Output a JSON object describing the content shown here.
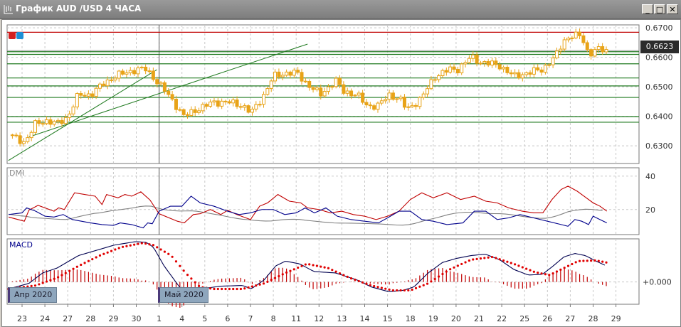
{
  "window": {
    "title": "График AUD /USD  4 ЧАСА",
    "buttons": {
      "minimize": "_",
      "maximize": "□",
      "close": "✕"
    }
  },
  "colors": {
    "candle": "#e8a317",
    "resistance": "#c00000",
    "support": "#1f7a1f",
    "plus_di": "#c00000",
    "minus_di": "#00008b",
    "adx": "#808080",
    "macd": "#000050",
    "signal": "#e00000",
    "grid": "#c8c8c8"
  },
  "price_panel": {
    "axis_labels": [
      "0.6700",
      "0.6600",
      "0.6500",
      "0.6400",
      "0.6300"
    ],
    "axis_values": [
      0.67,
      0.66,
      0.65,
      0.64,
      0.63
    ],
    "current_price": "0.6623",
    "current_value": 0.6623,
    "range": [
      0.624,
      0.671
    ],
    "resistance_level": 0.6685,
    "support_levels": [
      0.6619,
      0.661,
      0.6578,
      0.653,
      0.6503,
      0.6464,
      0.6399,
      0.638
    ],
    "trendlines": [
      {
        "from": [
          -0.6,
          0.625
        ],
        "to": [
          5.9,
          0.6558
        ]
      },
      {
        "from": [
          0.3,
          0.633
        ],
        "to": [
          12.5,
          0.6645
        ]
      }
    ],
    "price_path": [
      [
        -0.59,
        0.6337
      ],
      [
        0.13,
        0.6312
      ],
      [
        0.59,
        0.6374
      ],
      [
        1.0,
        0.6386
      ],
      [
        1.53,
        0.6374
      ],
      [
        2.0,
        0.6399
      ],
      [
        2.47,
        0.6473
      ],
      [
        3.0,
        0.6473
      ],
      [
        3.56,
        0.651
      ],
      [
        4.03,
        0.6535
      ],
      [
        5.0,
        0.6559
      ],
      [
        5.44,
        0.6559
      ],
      [
        6.0,
        0.651
      ],
      [
        6.53,
        0.646
      ],
      [
        7.09,
        0.6399
      ],
      [
        7.63,
        0.6423
      ],
      [
        8.41,
        0.6448
      ],
      [
        9.03,
        0.6448
      ],
      [
        9.66,
        0.6436
      ],
      [
        10.03,
        0.6411
      ],
      [
        10.59,
        0.6473
      ],
      [
        11.0,
        0.6535
      ],
      [
        11.53,
        0.6547
      ],
      [
        12.03,
        0.6547
      ],
      [
        12.47,
        0.651
      ],
      [
        13.06,
        0.6473
      ],
      [
        13.72,
        0.6522
      ],
      [
        14.06,
        0.6485
      ],
      [
        14.66,
        0.6473
      ],
      [
        15.09,
        0.6436
      ],
      [
        15.59,
        0.6436
      ],
      [
        16.06,
        0.6473
      ],
      [
        16.53,
        0.646
      ],
      [
        16.84,
        0.6423
      ],
      [
        17.47,
        0.646
      ],
      [
        18.06,
        0.6535
      ],
      [
        18.72,
        0.6559
      ],
      [
        19.06,
        0.6559
      ],
      [
        19.66,
        0.6601
      ],
      [
        20.06,
        0.6584
      ],
      [
        20.91,
        0.6572
      ],
      [
        21.53,
        0.6535
      ],
      [
        22.09,
        0.6547
      ],
      [
        22.78,
        0.6559
      ],
      [
        23.41,
        0.6609
      ],
      [
        23.72,
        0.6658
      ],
      [
        24.09,
        0.6675
      ],
      [
        24.5,
        0.667
      ],
      [
        24.81,
        0.6609
      ],
      [
        25.09,
        0.6626
      ],
      [
        25.59,
        0.6623
      ]
    ]
  },
  "dmi_panel": {
    "label": "DMI",
    "axis_labels": [
      "40",
      "20"
    ],
    "axis_values": [
      40,
      20
    ],
    "range": [
      5,
      45
    ],
    "plus_di": [
      [
        -0.59,
        15.5
      ],
      [
        0.1,
        13
      ],
      [
        0.3,
        19.6
      ],
      [
        0.7,
        22.5
      ],
      [
        1.4,
        19
      ],
      [
        1.6,
        21
      ],
      [
        1.85,
        20
      ],
      [
        2.3,
        30
      ],
      [
        3.2,
        28
      ],
      [
        3.5,
        23
      ],
      [
        3.7,
        29
      ],
      [
        4.2,
        27
      ],
      [
        4.5,
        29
      ],
      [
        4.8,
        28
      ],
      [
        5.2,
        30.6
      ],
      [
        5.6,
        25.7
      ],
      [
        6.0,
        17.5
      ],
      [
        6.8,
        13
      ],
      [
        7.1,
        12
      ],
      [
        7.5,
        17
      ],
      [
        7.8,
        17.5
      ],
      [
        8.25,
        20
      ],
      [
        8.7,
        17
      ],
      [
        9.0,
        19.5
      ],
      [
        9.4,
        17
      ],
      [
        10.0,
        14
      ],
      [
        10.4,
        22
      ],
      [
        10.75,
        24
      ],
      [
        11.2,
        29
      ],
      [
        11.7,
        25
      ],
      [
        12.2,
        24
      ],
      [
        12.5,
        21
      ],
      [
        13.0,
        20
      ],
      [
        13.5,
        18
      ],
      [
        14.0,
        19
      ],
      [
        14.5,
        17
      ],
      [
        15.0,
        16
      ],
      [
        15.5,
        14
      ],
      [
        16.0,
        16
      ],
      [
        16.5,
        19
      ],
      [
        17.0,
        26
      ],
      [
        17.5,
        30
      ],
      [
        18.0,
        27
      ],
      [
        18.6,
        30
      ],
      [
        19.2,
        26
      ],
      [
        19.8,
        28
      ],
      [
        20.3,
        25
      ],
      [
        20.8,
        24
      ],
      [
        21.3,
        21
      ],
      [
        21.9,
        19
      ],
      [
        22.4,
        18
      ],
      [
        22.8,
        18
      ],
      [
        23.2,
        26
      ],
      [
        23.6,
        32
      ],
      [
        23.9,
        34
      ],
      [
        24.3,
        31
      ],
      [
        24.6,
        28
      ],
      [
        25.0,
        24
      ],
      [
        25.3,
        22
      ],
      [
        25.6,
        19
      ]
    ],
    "minus_di": [
      [
        -0.59,
        17
      ],
      [
        0.0,
        18
      ],
      [
        0.2,
        21
      ],
      [
        0.6,
        19
      ],
      [
        1.0,
        16
      ],
      [
        1.4,
        15.5
      ],
      [
        1.8,
        17
      ],
      [
        2.2,
        14
      ],
      [
        3.0,
        12
      ],
      [
        3.5,
        11
      ],
      [
        4.0,
        10.5
      ],
      [
        4.3,
        12
      ],
      [
        4.8,
        11
      ],
      [
        5.3,
        9
      ],
      [
        5.5,
        12
      ],
      [
        5.7,
        11.5
      ],
      [
        6.0,
        19
      ],
      [
        6.5,
        22
      ],
      [
        7.0,
        22
      ],
      [
        7.4,
        28
      ],
      [
        7.8,
        24
      ],
      [
        8.4,
        22
      ],
      [
        9.0,
        19
      ],
      [
        9.5,
        17
      ],
      [
        10.0,
        18
      ],
      [
        10.5,
        20
      ],
      [
        11.0,
        20
      ],
      [
        11.5,
        17
      ],
      [
        12.0,
        18
      ],
      [
        12.4,
        21
      ],
      [
        12.8,
        18
      ],
      [
        13.3,
        21
      ],
      [
        13.8,
        16
      ],
      [
        14.4,
        14
      ],
      [
        15.0,
        13
      ],
      [
        15.6,
        12
      ],
      [
        16.0,
        15
      ],
      [
        16.5,
        19
      ],
      [
        17.0,
        19
      ],
      [
        17.5,
        14
      ],
      [
        18.0,
        13
      ],
      [
        18.6,
        11
      ],
      [
        19.3,
        12
      ],
      [
        19.8,
        19
      ],
      [
        20.3,
        19
      ],
      [
        20.8,
        14
      ],
      [
        21.3,
        15
      ],
      [
        21.8,
        17
      ],
      [
        22.4,
        15
      ],
      [
        23.0,
        13
      ],
      [
        23.6,
        11
      ],
      [
        23.9,
        10
      ],
      [
        24.2,
        14
      ],
      [
        24.5,
        13
      ],
      [
        24.8,
        11
      ],
      [
        25.0,
        16
      ],
      [
        25.3,
        14
      ],
      [
        25.6,
        12
      ]
    ]
  },
  "macd_panel": {
    "label": "MACD",
    "axis_label": "+0.000",
    "zero": 0,
    "range": [
      -0.0032,
      0.0062
    ],
    "macd": [
      [
        -0.59,
        -0.001
      ],
      [
        0.3,
        -0.0002
      ],
      [
        0.9,
        0.0013
      ],
      [
        1.53,
        0.002
      ],
      [
        2.47,
        0.0038
      ],
      [
        3.1,
        0.0044
      ],
      [
        4.03,
        0.0053
      ],
      [
        4.97,
        0.0058
      ],
      [
        5.44,
        0.0057
      ],
      [
        5.75,
        0.005
      ],
      [
        6.22,
        0.0023
      ],
      [
        7.0,
        -0.0012
      ],
      [
        7.8,
        -0.001
      ],
      [
        8.7,
        -0.0006
      ],
      [
        9.66,
        -0.0005
      ],
      [
        10.03,
        -0.001
      ],
      [
        10.6,
        0.0003
      ],
      [
        11.1,
        0.0023
      ],
      [
        11.53,
        0.003
      ],
      [
        12.16,
        0.0026
      ],
      [
        12.78,
        0.0015
      ],
      [
        13.72,
        0.0013
      ],
      [
        14.66,
        0.0003
      ],
      [
        15.28,
        -0.0007
      ],
      [
        16.06,
        -0.0014
      ],
      [
        16.69,
        -0.0012
      ],
      [
        17.16,
        -0.0007
      ],
      [
        17.78,
        0.0013
      ],
      [
        18.4,
        0.0028
      ],
      [
        19.03,
        0.0034
      ],
      [
        19.66,
        0.0038
      ],
      [
        20.28,
        0.004
      ],
      [
        20.91,
        0.0032
      ],
      [
        21.53,
        0.0018
      ],
      [
        22.16,
        0.001
      ],
      [
        22.78,
        0.0011
      ],
      [
        23.25,
        0.0023
      ],
      [
        23.72,
        0.0036
      ],
      [
        24.2,
        0.0041
      ],
      [
        24.66,
        0.0038
      ],
      [
        25.13,
        0.003
      ],
      [
        25.59,
        0.0023
      ]
    ],
    "signal": [
      [
        -0.59,
        -0.001
      ],
      [
        0.6,
        -0.0005
      ],
      [
        1.53,
        0.0006
      ],
      [
        2.47,
        0.0023
      ],
      [
        3.4,
        0.0038
      ],
      [
        4.34,
        0.005
      ],
      [
        5.28,
        0.0056
      ],
      [
        5.75,
        0.0053
      ],
      [
        6.53,
        0.0038
      ],
      [
        7.16,
        0.0013
      ],
      [
        7.78,
        -0.0007
      ],
      [
        8.4,
        -0.001
      ],
      [
        9.66,
        -0.001
      ],
      [
        10.6,
        -0.0002
      ],
      [
        11.53,
        0.0013
      ],
      [
        12.47,
        0.0026
      ],
      [
        13.4,
        0.002
      ],
      [
        14.34,
        0.0006
      ],
      [
        15.28,
        -0.0005
      ],
      [
        16.22,
        -0.0012
      ],
      [
        17.0,
        -0.0012
      ],
      [
        17.78,
        -0.0002
      ],
      [
        18.72,
        0.0018
      ],
      [
        19.66,
        0.0032
      ],
      [
        20.6,
        0.0036
      ],
      [
        21.53,
        0.0026
      ],
      [
        22.47,
        0.0014
      ],
      [
        23.1,
        0.001
      ],
      [
        23.72,
        0.002
      ],
      [
        24.34,
        0.003
      ],
      [
        25.13,
        0.0031
      ],
      [
        25.59,
        0.0028
      ]
    ]
  },
  "x_axis": {
    "labels": [
      "23",
      "24",
      "27",
      "28",
      "29",
      "30",
      "1",
      "4",
      "5",
      "6",
      "7",
      "8",
      "11",
      "12",
      "13",
      "14",
      "15",
      "18",
      "19",
      "20",
      "21",
      "22",
      "25",
      "26",
      "27",
      "28",
      "29"
    ],
    "month_markers": [
      {
        "label": "Апр 2020",
        "day_index": -0.59
      },
      {
        "label": "Май 2020",
        "day_index": 6
      }
    ]
  }
}
